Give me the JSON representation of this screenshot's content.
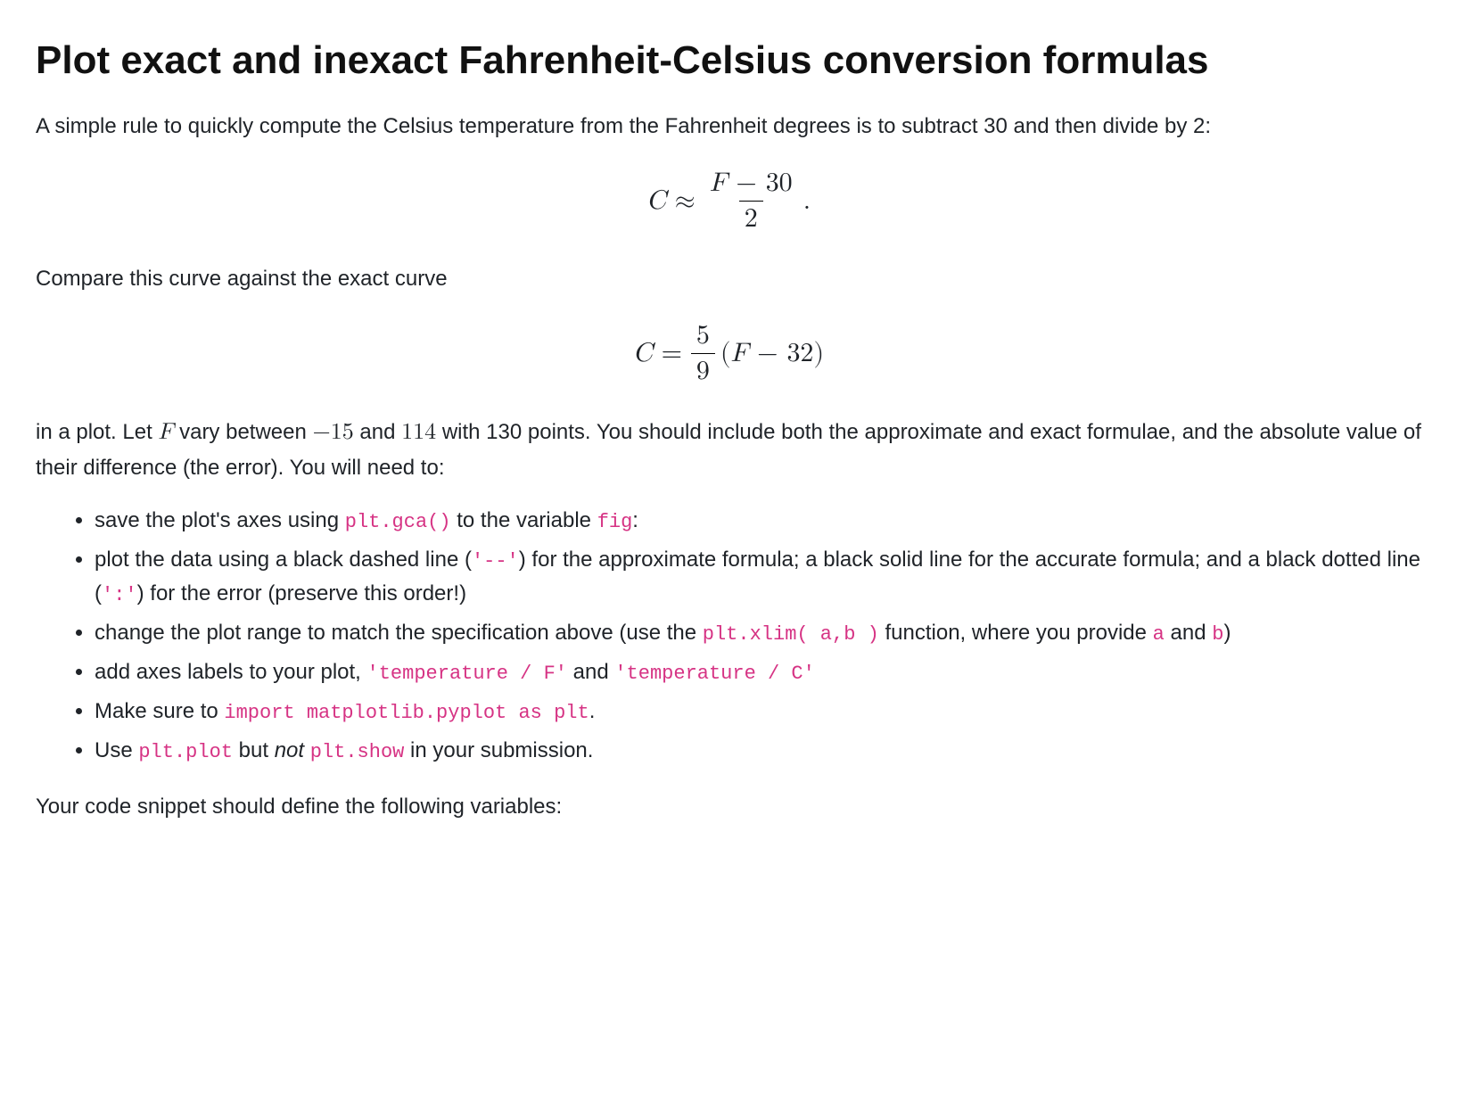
{
  "title": "Plot exact and inexact Fahrenheit-Celsius conversion formulas",
  "p1": "A simple rule to quickly compute the Celsius temperature from the Fahrenheit degrees is to subtract 30 and then divide by 2:",
  "formula1": {
    "lhs_C": "C",
    "approx": "≈",
    "num_F": "F",
    "num_minus": " − ",
    "num_30": "30",
    "den_2": "2",
    "period": "."
  },
  "p2": "Compare this curve against the exact curve",
  "formula2": {
    "lhs_C": "C",
    "eq": "=",
    "num_5": "5",
    "den_9": "9",
    "lparen": "(",
    "F": "F",
    "minus": " − ",
    "thirtytwo": "32",
    "rparen": ")"
  },
  "p3_a": "in a plot. Let ",
  "p3_F": "F",
  "p3_b": " vary between ",
  "p3_neg15": "−15",
  "p3_c": " and ",
  "p3_114": "114",
  "p3_d": " with 130 points. You should include both the approximate and exact formulae, and the absolute value of their difference (the error). You will need to:",
  "bullets": {
    "b1_a": "save the plot's axes using ",
    "b1_code1": "plt.gca()",
    "b1_b": " to the variable ",
    "b1_code2": "fig",
    "b1_c": ":",
    "b2_a": "plot the data using a black dashed line (",
    "b2_code1": "'--'",
    "b2_b": ") for the approximate formula; a black solid line for the accurate formula; and a black dotted line (",
    "b2_code2": "':'",
    "b2_c": ") for the error (preserve this order!)",
    "b3_a": "change the plot range to match the specification above (use the ",
    "b3_code1": "plt.xlim( a,b )",
    "b3_b": " function, where you provide ",
    "b3_code2": "a",
    "b3_c": " and ",
    "b3_code3": "b",
    "b3_d": ")",
    "b4_a": "add axes labels to your plot, ",
    "b4_code1": "'temperature / F'",
    "b4_b": " and ",
    "b4_code2": "'temperature / C'",
    "b5_a": "Make sure to ",
    "b5_code1": "import matplotlib.pyplot as plt",
    "b5_b": ".",
    "b6_a": "Use ",
    "b6_code1": "plt.plot",
    "b6_b": " but ",
    "b6_em": "not",
    "b6_c": " ",
    "b6_code2": "plt.show",
    "b6_d": " in your submission."
  },
  "p4": "Your code snippet should define the following variables:"
}
